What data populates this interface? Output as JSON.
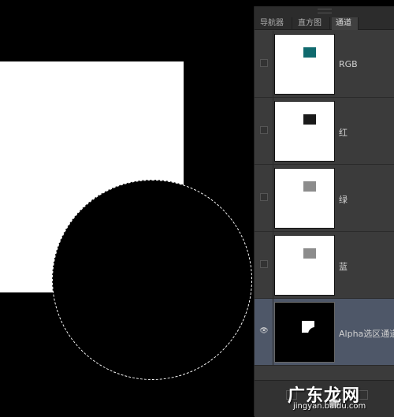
{
  "panel": {
    "tabs": [
      {
        "label": "导航器"
      },
      {
        "label": "直方图"
      },
      {
        "label": "通道"
      }
    ],
    "channels": [
      {
        "label": "RGB",
        "swatch_color": "#106a6e",
        "visible": false
      },
      {
        "label": "红",
        "swatch_color": "#1a1a1a",
        "visible": false
      },
      {
        "label": "绿",
        "swatch_color": "#8c8c8c",
        "visible": false
      },
      {
        "label": "蓝",
        "swatch_color": "#8c8c8c",
        "visible": false
      },
      {
        "label": "Alpha选区通道",
        "swatch_color": "#ffffff",
        "visible": true,
        "selected": true
      }
    ]
  },
  "watermark": {
    "brand": "广东龙网",
    "url": "jingyan.baidu.com"
  },
  "colors": {
    "panel_bg": "#3b3b3b",
    "selected_row": "#4e5768",
    "canvas_bg": "#000000"
  }
}
